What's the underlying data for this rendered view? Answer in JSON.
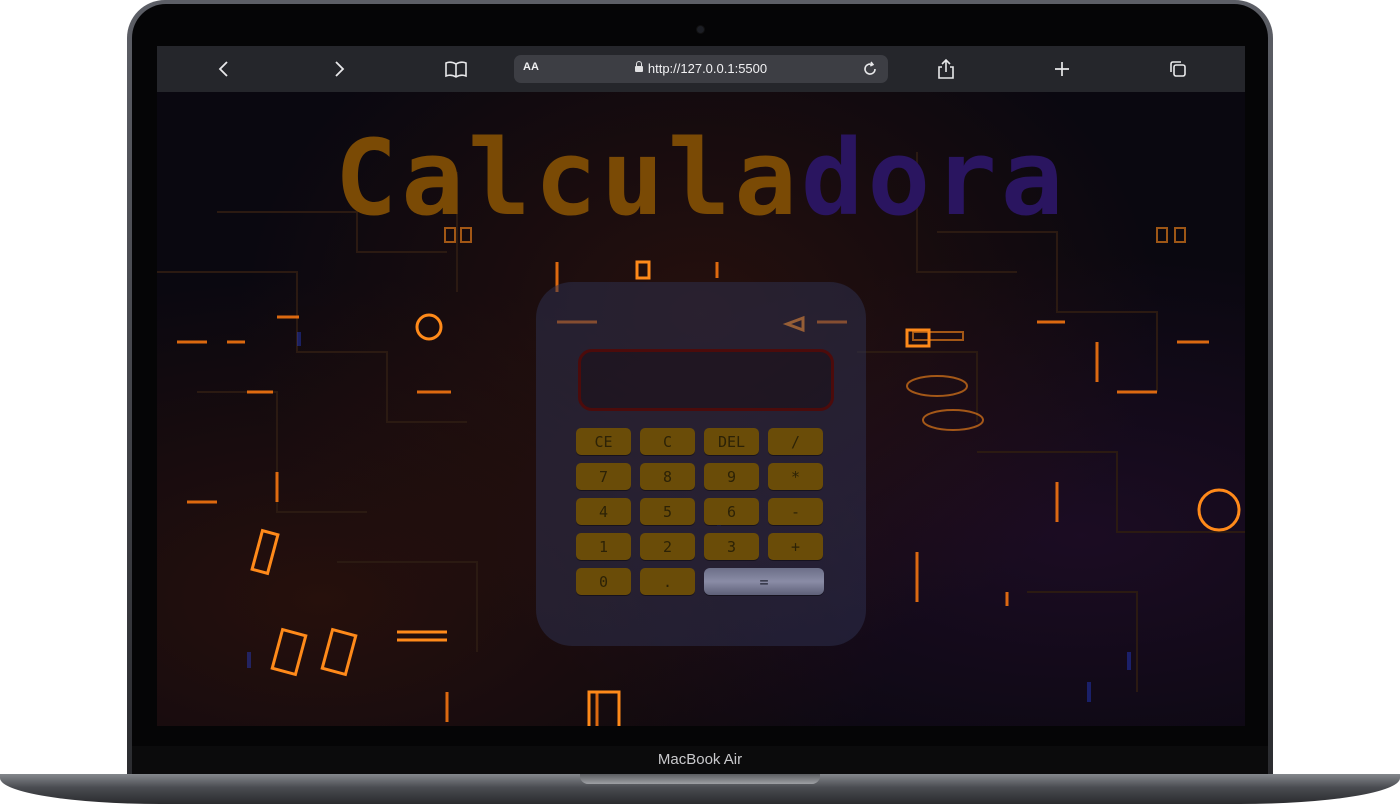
{
  "device": {
    "model_label": "MacBook Air"
  },
  "browser": {
    "back_icon": "chevron-left-icon",
    "forward_icon": "chevron-right-icon",
    "bookmarks_icon": "book-icon",
    "reader_label": "AA",
    "url": "http://127.0.0.1:5500",
    "reload_icon": "reload-icon",
    "share_icon": "share-icon",
    "new_tab_icon": "plus-icon",
    "tabs_icon": "tabs-icon"
  },
  "page": {
    "title_part1": "Calcula",
    "title_part2": "dora",
    "colors": {
      "title_part1": "#7a4a05",
      "title_part2": "#2a1560",
      "key": "#6a4c08",
      "display_border": "#4c0b0b"
    }
  },
  "calculator": {
    "display_value": "",
    "keys": [
      [
        "CE",
        "C",
        "DEL",
        "/"
      ],
      [
        "7",
        "8",
        "9",
        "*"
      ],
      [
        "4",
        "5",
        "6",
        "-"
      ],
      [
        "1",
        "2",
        "3",
        "+"
      ],
      [
        "0",
        ".",
        "="
      ]
    ]
  }
}
